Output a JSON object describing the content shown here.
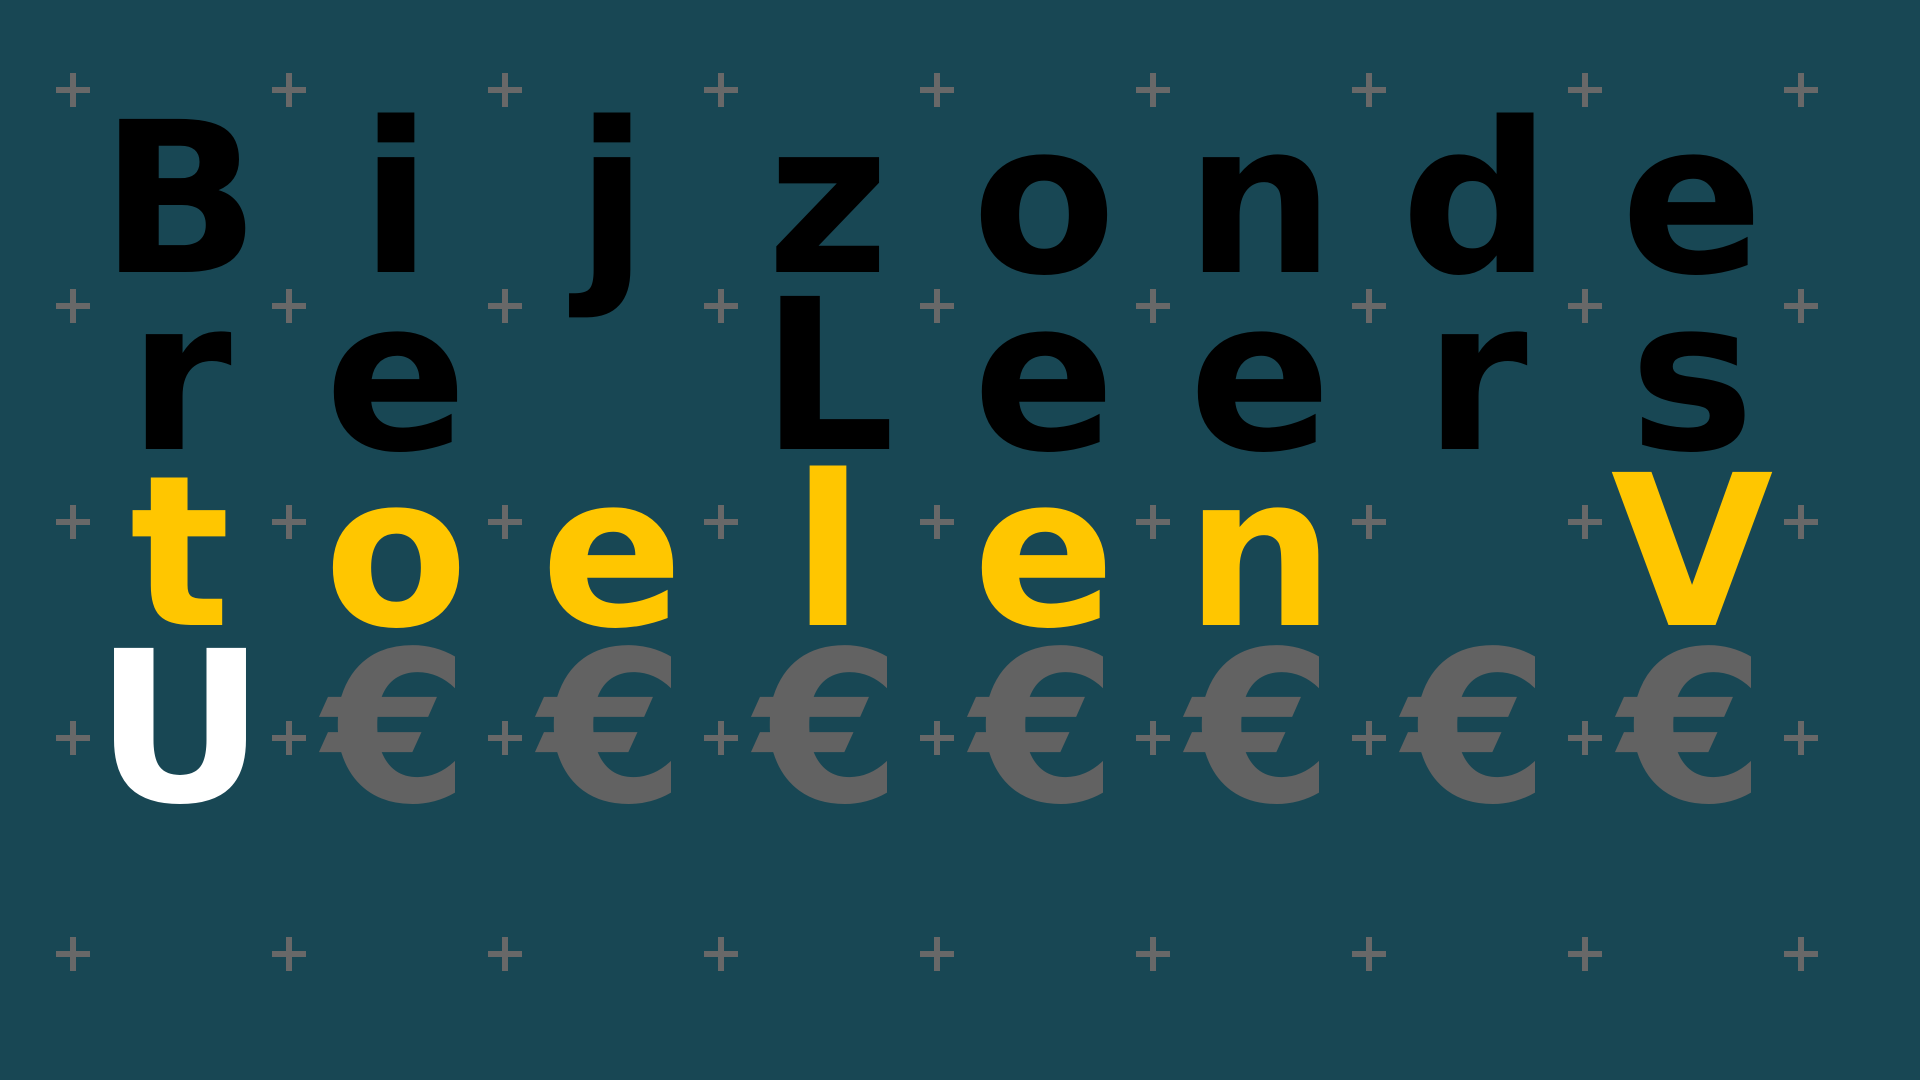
{
  "rows": [
    {
      "row": 1,
      "color": "#000000",
      "chars": [
        "B",
        "i",
        "j",
        "z",
        "o",
        "n",
        "d",
        "e"
      ]
    },
    {
      "row": 2,
      "color": "#000000",
      "chars": [
        "r",
        "e",
        " ",
        "L",
        "e",
        "e",
        "r",
        "s"
      ]
    },
    {
      "row": 3,
      "color": "#FFC600",
      "chars": [
        "t",
        "o",
        "e",
        "l",
        "e",
        "n",
        " ",
        "V"
      ]
    },
    {
      "row": 4,
      "colors": [
        "#FFFFFF",
        "#626262",
        "#626262",
        "#626262",
        "#626262",
        "#626262",
        "#626262",
        "#626262"
      ],
      "chars": [
        "U",
        "€",
        "€",
        "€",
        "€",
        "€",
        "€",
        "€"
      ]
    }
  ],
  "palette": {
    "background": "#184754",
    "plus": "#686868"
  },
  "icons": {
    "grid_marker": "plus-sign-icon"
  }
}
